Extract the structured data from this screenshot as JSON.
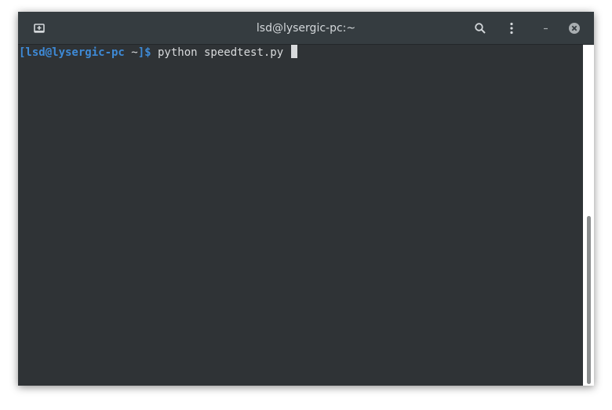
{
  "window": {
    "title": "lsd@lysergic-pc:~"
  },
  "titlebar": {
    "icons": {
      "new_tab": "new-tab-icon",
      "search": "search-icon",
      "menu": "kebab-menu-icon",
      "minimize": "minimize-icon",
      "close": "close-icon"
    }
  },
  "terminal": {
    "prompt_user_host": "[lsd@lysergic-pc",
    "prompt_dir": " ~",
    "prompt_end": "]$",
    "command": " python speedtest.py "
  },
  "colors": {
    "background": "#2f3336",
    "titlebar": "#353c40",
    "prompt": "#3e8ad6",
    "text": "#d8dadc"
  }
}
